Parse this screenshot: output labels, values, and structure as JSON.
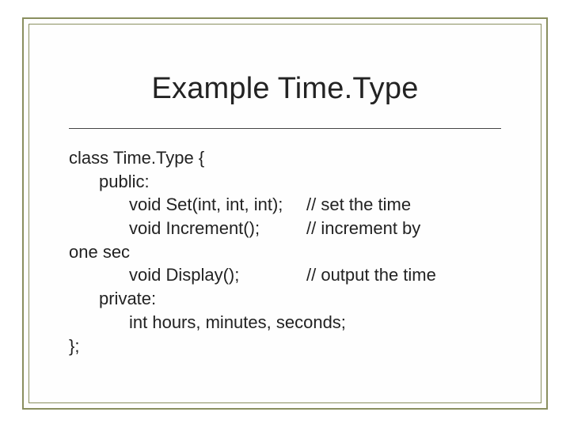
{
  "title": "Example Time.Type",
  "code": {
    "l0": "class Time.Type {",
    "l1": "public:",
    "l2a": "void Set(int, int, int);",
    "l2b": "// set the time",
    "l3a": "void Increment();",
    "l3b": "// increment by",
    "l4": "one sec",
    "l5a": "void Display();",
    "l5b": "// output the time",
    "l6": "private:",
    "l7": "int hours, minutes, seconds;",
    "l8": "};"
  }
}
